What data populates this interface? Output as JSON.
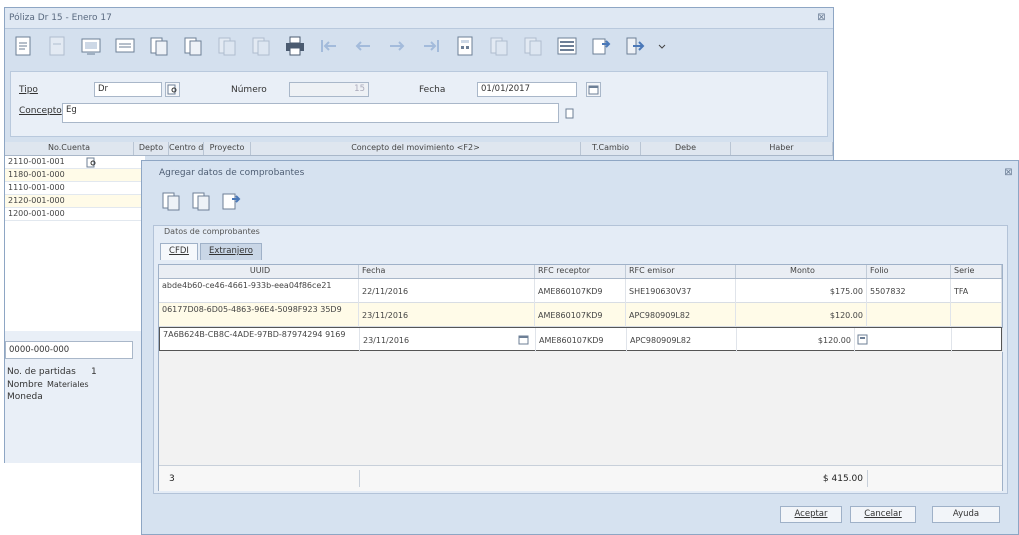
{
  "window1": {
    "title": "Póliza Dr   15 - Enero 17",
    "close": "⊠",
    "form": {
      "tipo_label": "Tipo",
      "tipo_value": "Dr",
      "numero_label": "Número",
      "numero_value": "15",
      "fecha_label": "Fecha",
      "fecha_value": "01/01/2017",
      "concepto_label": "Concepto",
      "concepto_value": "Eg"
    },
    "columns": [
      "No.Cuenta",
      "Depto",
      "Centro de",
      "Proyecto",
      "Concepto del movimiento <F2>",
      "T.Cambio",
      "Debe",
      "Haber"
    ],
    "accounts": [
      "2110-001-001",
      "1180-001-000",
      "1110-001-000",
      "2120-001-000",
      "1200-001-000"
    ],
    "bottom_account": "0000-000-000",
    "info": {
      "partidas_label": "No. de partidas",
      "partidas_value": "1",
      "nombre_label": "Nombre",
      "nombre_value": "Materiales",
      "moneda_label": "Moneda"
    }
  },
  "dialog": {
    "title": "Agregar datos de comprobantes",
    "close": "⊠",
    "group_label": "Datos de comprobantes",
    "tabs": [
      "CFDI",
      "Extranjero"
    ],
    "columns": [
      "UUID",
      "Fecha",
      "RFC receptor",
      "RFC emisor",
      "Monto",
      "Folio",
      "Serie"
    ],
    "rows": [
      {
        "uuid": "abde4b60-ce46-4661-933b-eea04f86ce21",
        "fecha": "22/11/2016",
        "rfc_receptor": "AME860107KD9",
        "rfc_emisor": "SHE190630V37",
        "monto": "$175.00",
        "folio": "5507832",
        "serie": "TFA"
      },
      {
        "uuid": "06177D08-6D05-4863-96E4-5098F923 35D9",
        "fecha": "23/11/2016",
        "rfc_receptor": "AME860107KD9",
        "rfc_emisor": "APC980909L82",
        "monto": "$120.00",
        "folio": "",
        "serie": ""
      },
      {
        "uuid": "7A6B624B-CB8C-4ADE-97BD-87974294 9169",
        "fecha": "23/11/2016",
        "rfc_receptor": "AME860107KD9",
        "rfc_emisor": "APC980909L82",
        "monto": "$120.00",
        "folio": "",
        "serie": ""
      }
    ],
    "footer_count": "3",
    "footer_total": "$ 415.00",
    "buttons": {
      "accept": "Aceptar",
      "cancel": "Cancelar",
      "help": "Ayuda"
    }
  },
  "colors": {
    "accent": "#4a78b8",
    "window_bg": "#d4e0ee",
    "grid_alt_row": "#fffbe8",
    "grid_selected": "#ffffff"
  }
}
